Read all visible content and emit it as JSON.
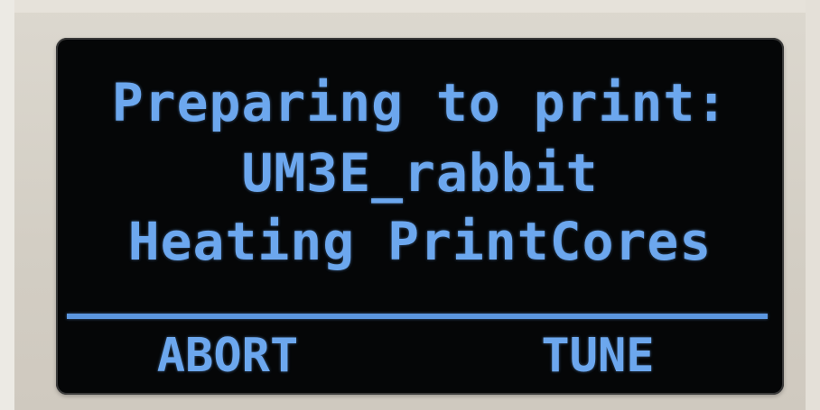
{
  "display": {
    "status_line": "Preparing to print:",
    "job_name": "UM3E_rabbit",
    "progress_line": "Heating PrintCores",
    "text_color": "#6ca7ee",
    "background_color": "#050607"
  },
  "softkeys": {
    "left_label": "ABORT",
    "right_label": "TUNE"
  }
}
